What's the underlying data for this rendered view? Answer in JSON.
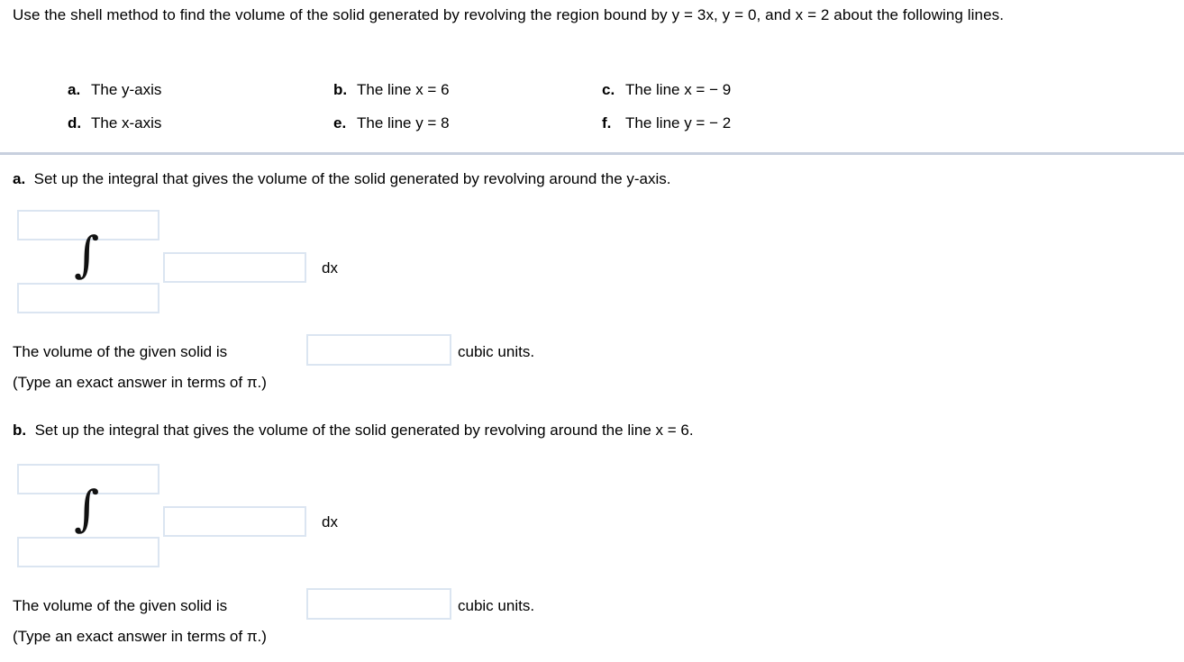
{
  "problem": {
    "statement": "Use the shell method to find the volume of the solid generated by revolving the region bound by y = 3x, y = 0, and x = 2 about the following lines."
  },
  "choices": [
    {
      "letter": "a.",
      "text": "The y-axis"
    },
    {
      "letter": "b.",
      "text": "The line x = 6"
    },
    {
      "letter": "c.",
      "text": "The line x = − 9"
    },
    {
      "letter": "d.",
      "text": "The x-axis"
    },
    {
      "letter": "e.",
      "text": "The line y = 8"
    },
    {
      "letter": "f.",
      "text": "The line y = − 2"
    }
  ],
  "sections": [
    {
      "label": "a.",
      "prompt": "Set up the integral that gives the volume of the solid generated by revolving around the y-axis.",
      "integral": {
        "sign": "∫",
        "upper_limit_value": "",
        "lower_limit_value": "",
        "integrand_value": "",
        "differential": "dx"
      },
      "answer": {
        "prefix": "The volume of the given solid is",
        "value": "",
        "suffix": "cubic units.",
        "note": "(Type an exact answer in terms of π.)"
      }
    },
    {
      "label": "b.",
      "prompt": "Set up the integral that gives the volume of the solid generated by revolving around the line x = 6.",
      "integral": {
        "sign": "∫",
        "upper_limit_value": "",
        "lower_limit_value": "",
        "integrand_value": "",
        "differential": "dx"
      },
      "answer": {
        "prefix": "The volume of the given solid is",
        "value": "",
        "suffix": "cubic units.",
        "note": "(Type an exact answer in terms of π.)"
      }
    }
  ],
  "style": {
    "divider_color": "#c8d0de",
    "input_border_color": "#dbe5f1",
    "background": "#ffffff",
    "text_color": "#000000"
  }
}
